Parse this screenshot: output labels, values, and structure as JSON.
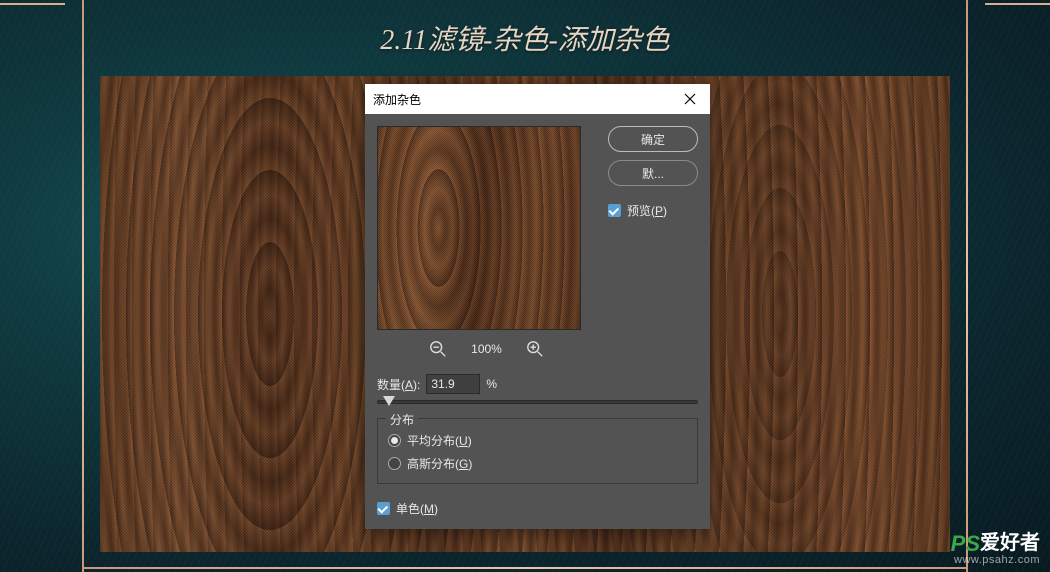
{
  "tutorial_title": "2.11滤镜-杂色-添加杂色",
  "dialog": {
    "title": "添加杂色",
    "ok": "确定",
    "cancel": "默...",
    "preview_label": "预览",
    "preview_hotkey": "P",
    "zoom_level": "100%",
    "amount_label": "数量",
    "amount_hotkey": "A",
    "amount_value": "31.9",
    "amount_unit": "%",
    "distribution_label": "分布",
    "uniform_label": "平均分布",
    "uniform_hotkey": "U",
    "gaussian_label": "高斯分布",
    "gaussian_hotkey": "G",
    "mono_label": "单色",
    "mono_hotkey": "M"
  },
  "watermark": {
    "brand_ps": "PS",
    "brand_cn": "爱好者",
    "url": "www.psahz.com"
  }
}
